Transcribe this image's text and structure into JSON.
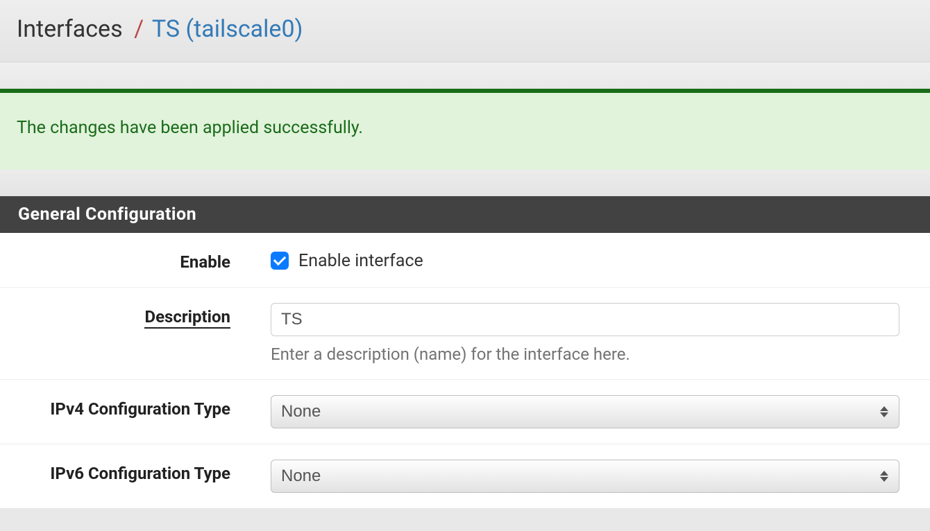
{
  "breadcrumb": {
    "root": "Interfaces",
    "separator": "/",
    "current": "TS (tailscale0)"
  },
  "alert": {
    "message": "The changes have been applied successfully."
  },
  "panel": {
    "title": "General Configuration"
  },
  "form": {
    "enable": {
      "label": "Enable",
      "checkbox_label": "Enable interface",
      "checked": true
    },
    "description": {
      "label": "Description",
      "value": "TS",
      "help": "Enter a description (name) for the interface here."
    },
    "ipv4": {
      "label": "IPv4 Configuration Type",
      "value": "None"
    },
    "ipv6": {
      "label": "IPv6 Configuration Type",
      "value": "None"
    }
  }
}
